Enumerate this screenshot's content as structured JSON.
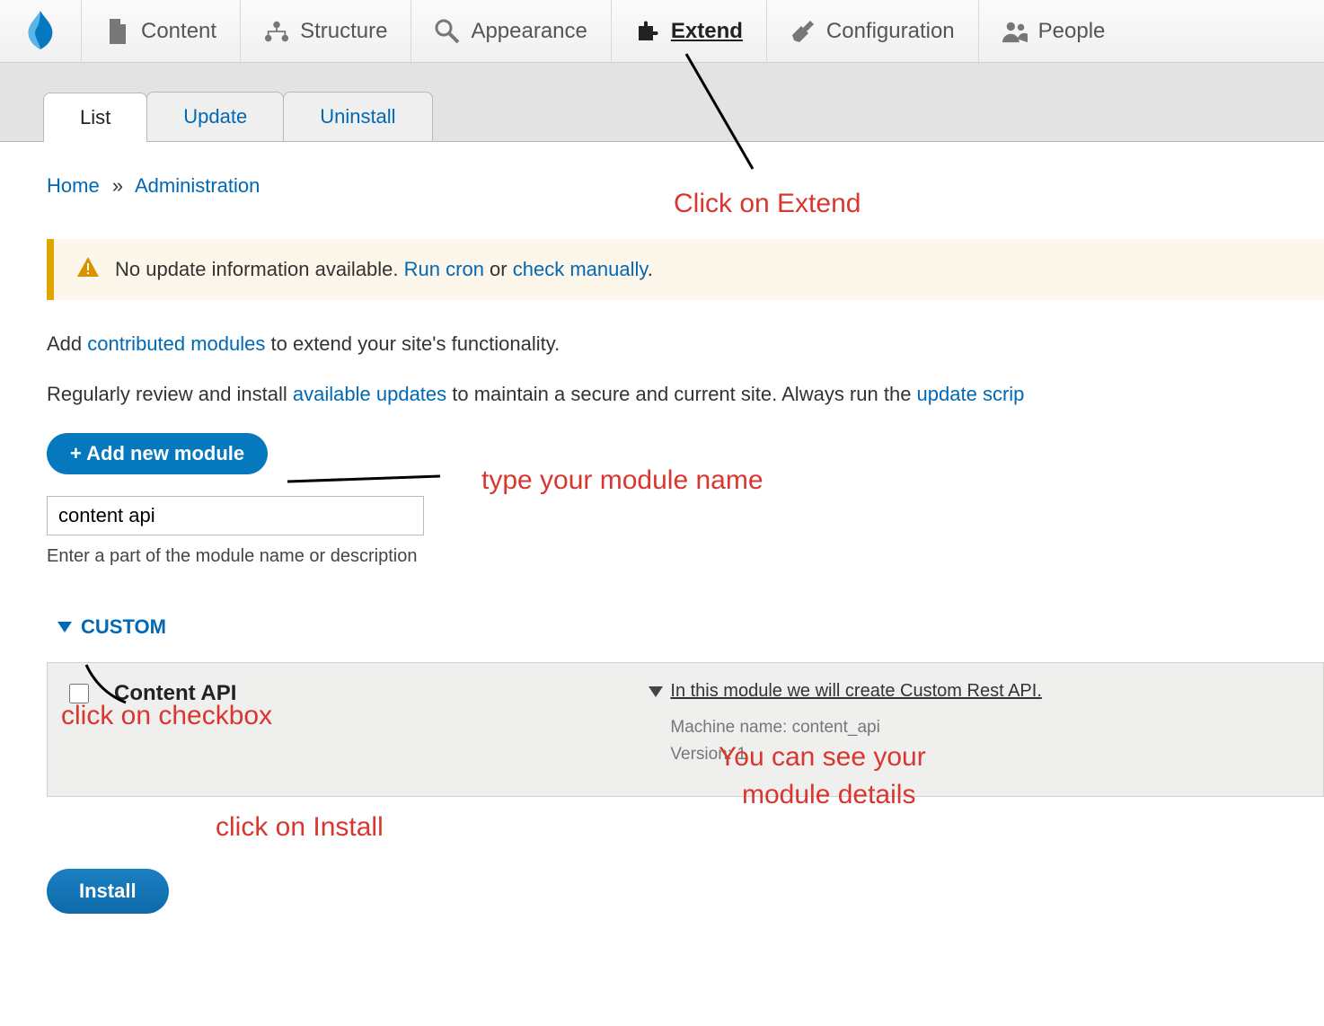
{
  "toolbar": {
    "items": [
      {
        "label": "Content",
        "icon": "content-icon"
      },
      {
        "label": "Structure",
        "icon": "structure-icon"
      },
      {
        "label": "Appearance",
        "icon": "appearance-icon"
      },
      {
        "label": "Extend",
        "icon": "extend-icon",
        "active": true
      },
      {
        "label": "Configuration",
        "icon": "configuration-icon"
      },
      {
        "label": "People",
        "icon": "people-icon"
      }
    ]
  },
  "tabs": [
    {
      "label": "List",
      "active": true
    },
    {
      "label": "Update"
    },
    {
      "label": "Uninstall"
    }
  ],
  "breadcrumb": {
    "home": "Home",
    "admin": "Administration",
    "sep": "»"
  },
  "warning": {
    "text_before": "No update information available. ",
    "link1": "Run cron",
    "mid": " or ",
    "link2": "check manually",
    "period": "."
  },
  "para1": {
    "before": "Add ",
    "link": "contributed modules",
    "after": " to extend your site's functionality."
  },
  "para2": {
    "before": "Regularly review and install ",
    "link1": "available updates",
    "mid": " to maintain a secure and current site. Always run the ",
    "link2": "update scrip"
  },
  "add_button": "+ Add new module",
  "search": {
    "value": "content api",
    "help": "Enter a part of the module name or description"
  },
  "section": {
    "title": "CUSTOM"
  },
  "module": {
    "name": "Content API",
    "desc": "In this module we will create Custom Rest API.",
    "machine_label": "Machine name:",
    "machine_name": "content_api",
    "version_label": "Version:",
    "version": "1"
  },
  "install_button": "Install",
  "annotations": {
    "extend": "Click on Extend",
    "type": "type your module name",
    "checkbox": "click on checkbox",
    "install": "click on Install",
    "details1": "You can see your",
    "details2": "module details"
  }
}
